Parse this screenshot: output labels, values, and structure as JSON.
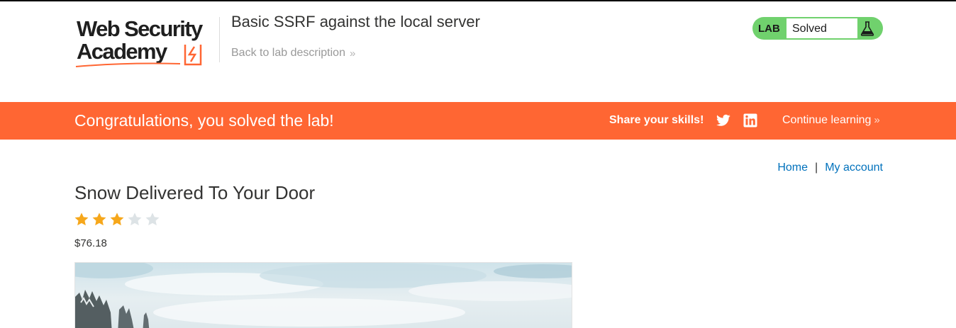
{
  "header": {
    "logo_line1": "Web Security",
    "logo_line2": "Academy",
    "lab_title": "Basic SSRF against the local server",
    "back_link": "Back to lab description",
    "back_chevron": "»",
    "status_tag": "LAB",
    "status_value": "Solved",
    "status_color": "#70d16d"
  },
  "banner": {
    "message": "Congratulations, you solved the lab!",
    "share_label": "Share your skills!",
    "continue_label": "Continue learning",
    "continue_chevron": "»",
    "color": "#ff6633"
  },
  "nav": {
    "home": "Home",
    "separator": "|",
    "account": "My account",
    "link_color": "#0071bc"
  },
  "product": {
    "title": "Snow Delivered To Your Door",
    "rating": 3,
    "rating_max": 5,
    "price": "$76.18",
    "star_color": "#f6a71b",
    "star_empty_color": "#dde3e6"
  },
  "icons": {
    "logo_mark": "academy-bolt-icon",
    "status": "flask-icon",
    "share1": "twitter-icon",
    "share2": "linkedin-icon"
  }
}
